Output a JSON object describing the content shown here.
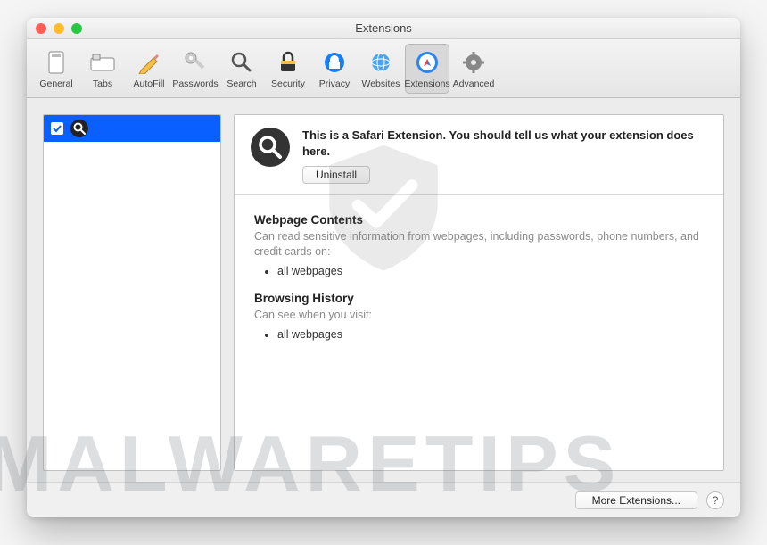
{
  "window": {
    "title": "Extensions"
  },
  "toolbar": {
    "items": [
      {
        "label": "General"
      },
      {
        "label": "Tabs"
      },
      {
        "label": "AutoFill"
      },
      {
        "label": "Passwords"
      },
      {
        "label": "Search"
      },
      {
        "label": "Security"
      },
      {
        "label": "Privacy"
      },
      {
        "label": "Websites"
      },
      {
        "label": "Extensions"
      },
      {
        "label": "Advanced"
      }
    ]
  },
  "header": {
    "description": "This is a Safari Extension. You should tell us what your extension does here.",
    "uninstall_label": "Uninstall"
  },
  "permissions": {
    "webpage_title": "Webpage Contents",
    "webpage_desc": "Can read sensitive information from webpages, including passwords, phone numbers, and credit cards on:",
    "webpage_bullet": "all webpages",
    "history_title": "Browsing History",
    "history_desc": "Can see when you visit:",
    "history_bullet": "all webpages"
  },
  "footer": {
    "more_label": "More Extensions...",
    "help_label": "?"
  },
  "watermark": "MALWARETIPS"
}
